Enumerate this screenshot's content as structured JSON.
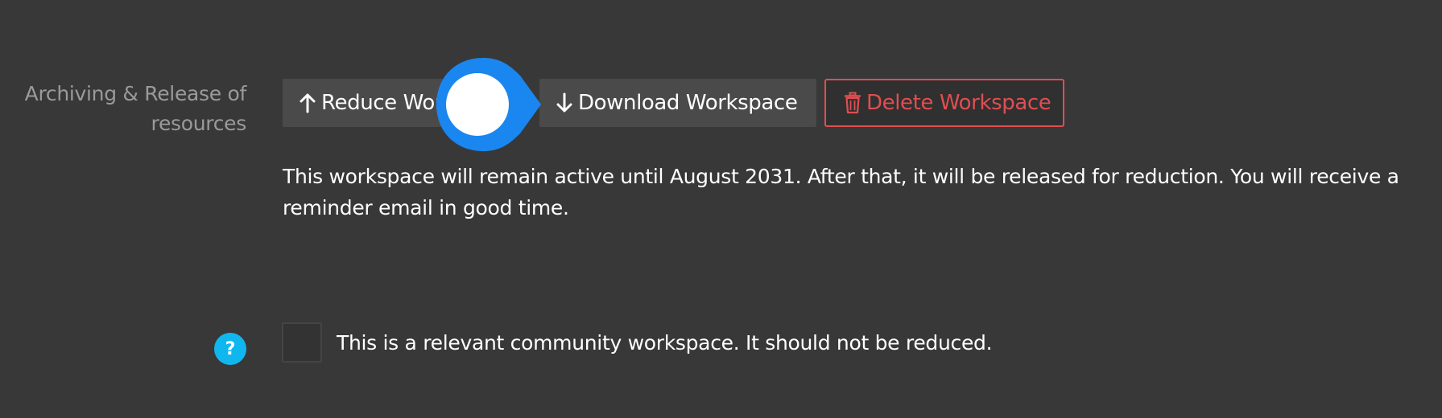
{
  "section": {
    "label_line1": "Archiving & Release of",
    "label_line2": "resources"
  },
  "buttons": {
    "reduce": {
      "label": "Reduce Workspace",
      "icon": "arrow-up-icon"
    },
    "download": {
      "label": "Download Workspace",
      "icon": "arrow-down-icon"
    },
    "delete": {
      "label": "Delete Workspace",
      "icon": "trash-icon"
    }
  },
  "info": {
    "text": "This workspace will remain active until August 2031. After that, it will be released for reduction. You will receive a reminder email in good time."
  },
  "community": {
    "help_icon": "question-mark-icon",
    "help_glyph": "?",
    "checked": false,
    "label": "This is a relevant community workspace. It should not be reduced."
  },
  "colors": {
    "background": "#383838",
    "button": "#4a4a4a",
    "danger": "#e04e51",
    "help": "#10b7ef",
    "pointer": "#1a86f0"
  }
}
